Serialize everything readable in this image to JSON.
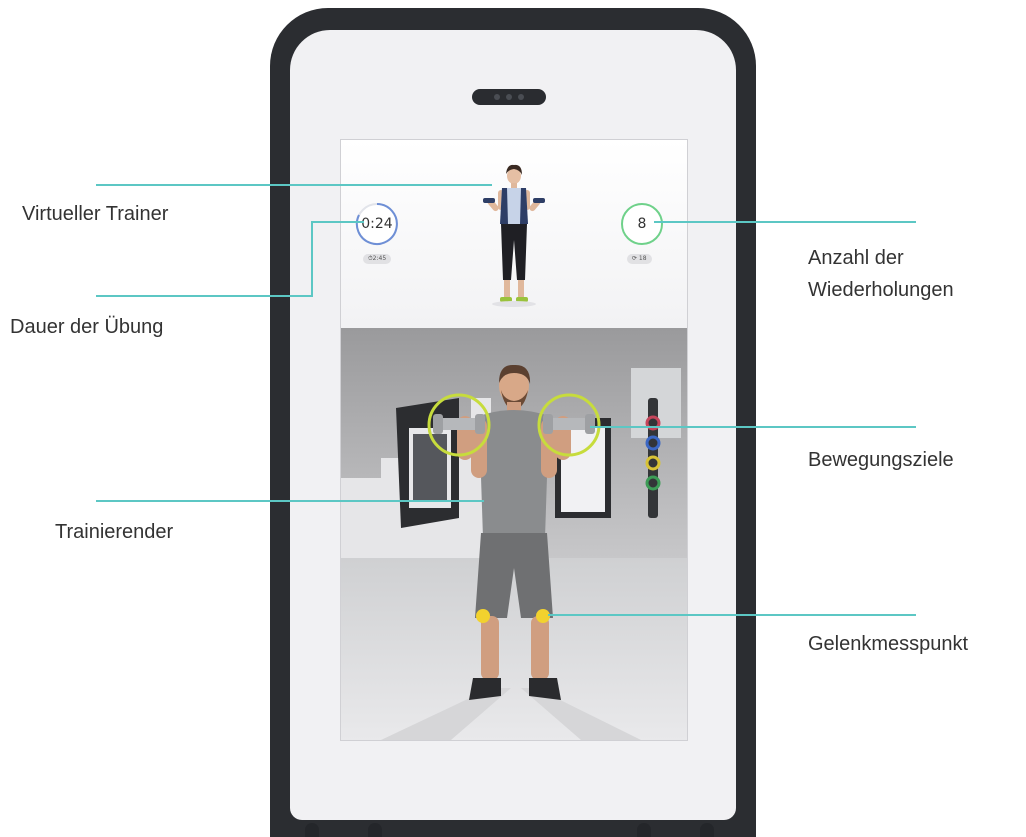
{
  "screen": {
    "timer_value": "0:24",
    "timer_total": "⏱2:45",
    "reps_value": "8",
    "reps_total": "⟳ 18"
  },
  "callouts": {
    "virtual_trainer": "Virtueller Trainer",
    "exercise_duration": "Dauer der Übung",
    "trainee": "Trainierender",
    "repetitions": "Anzahl der Wiederholungen",
    "movement_targets": "Bewegungsziele",
    "joint_measure_point": "Gelenkmesspunkt"
  },
  "colors": {
    "leader_line": "#5cc7c4",
    "timer_ring": "#6e8fd6",
    "reps_ring": "#6fd18a",
    "target_ring": "#c7dc3c",
    "joint_point": "#f2d22e",
    "device_frame": "#2b2d31"
  }
}
